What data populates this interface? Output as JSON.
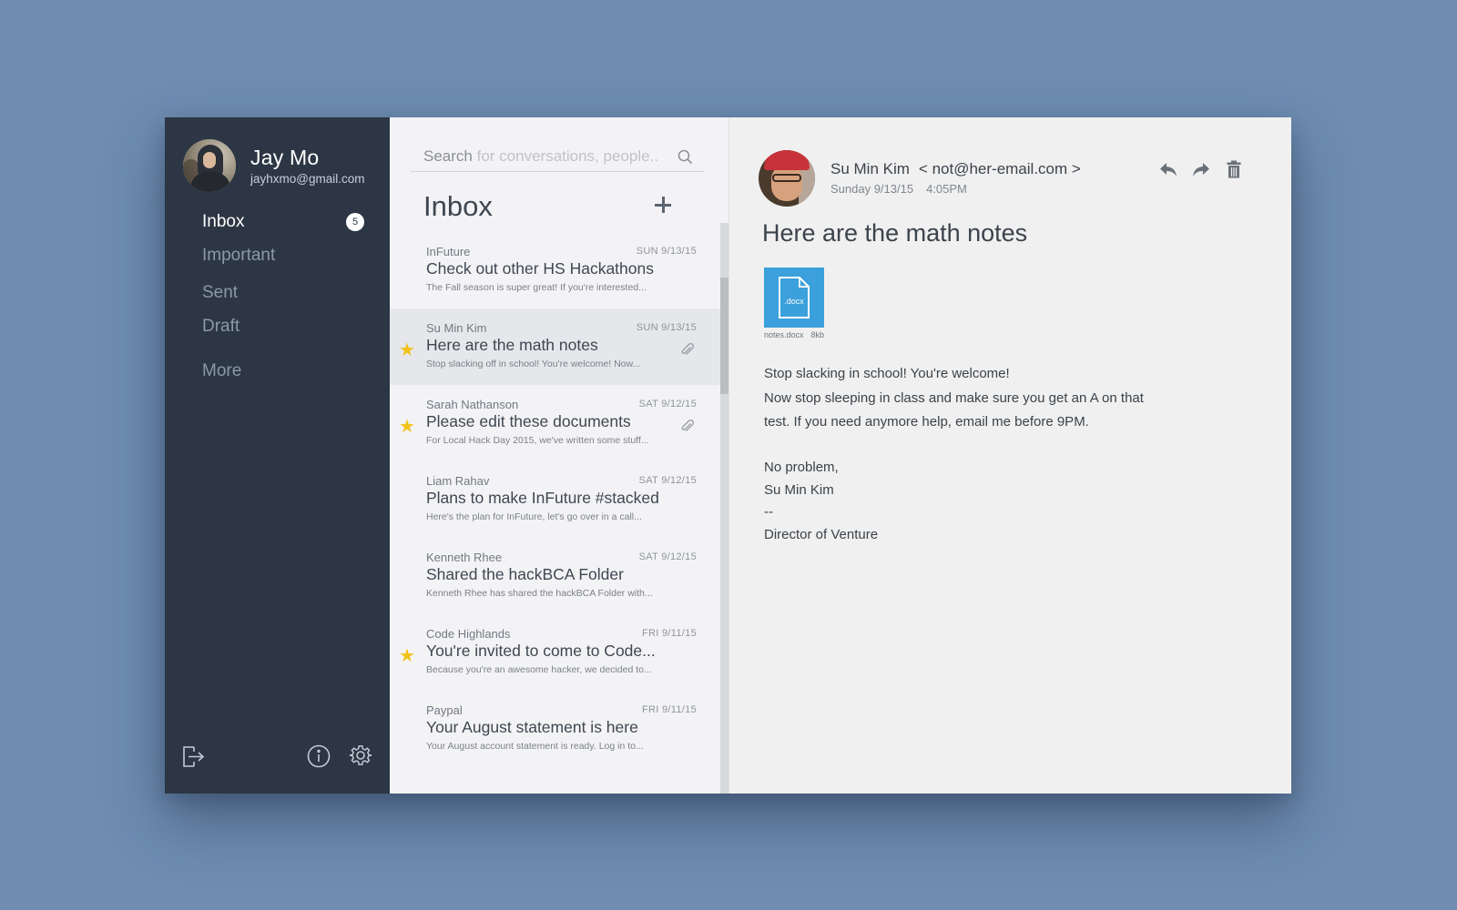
{
  "user": {
    "name": "Jay Mo",
    "email": "jayhxmo@gmail.com"
  },
  "nav": {
    "items": [
      {
        "label": "Inbox",
        "badge": "5",
        "active": true
      },
      {
        "label": "Important"
      },
      {
        "label": "Sent"
      },
      {
        "label": "Draft"
      },
      {
        "label": "More"
      }
    ]
  },
  "footer_icons": [
    "logout-icon",
    "info-icon",
    "gear-icon"
  ],
  "search": {
    "label": "Search",
    "placeholder": "for conversations, people.."
  },
  "list": {
    "title": "Inbox",
    "messages": [
      {
        "from": "InFuture",
        "date": "SUN 9/13/15",
        "subject": "Check out other HS Hackathons",
        "preview": "The Fall season is super great!  If you're interested...",
        "starred": false,
        "attachment": false,
        "selected": false
      },
      {
        "from": "Su Min Kim",
        "date": "SUN 9/13/15",
        "subject": "Here are the math notes",
        "preview": "Stop slacking off in school! You're welcome! Now...",
        "starred": true,
        "attachment": true,
        "selected": true
      },
      {
        "from": "Sarah Nathanson",
        "date": "SAT 9/12/15",
        "subject": "Please edit these documents",
        "preview": "For Local Hack Day 2015, we've written some stuff...",
        "starred": true,
        "attachment": true,
        "selected": false
      },
      {
        "from": "Liam Rahav",
        "date": "SAT 9/12/15",
        "subject": "Plans to make InFuture #stacked",
        "preview": "Here's the plan for InFuture, let's go over in a call...",
        "starred": false,
        "attachment": false,
        "selected": false
      },
      {
        "from": "Kenneth Rhee",
        "date": "SAT 9/12/15",
        "subject": "Shared the hackBCA Folder",
        "preview": "Kenneth Rhee has shared the hackBCA Folder with...",
        "starred": false,
        "attachment": false,
        "selected": false
      },
      {
        "from": "Code Highlands",
        "date": "FRI 9/11/15",
        "subject": "You're invited to come to Code...",
        "preview": "Because you're an awesome hacker, we decided to...",
        "starred": true,
        "attachment": false,
        "selected": false
      },
      {
        "from": "Paypal",
        "date": "FRI 9/11/15",
        "subject": "Your August statement is here",
        "preview": "Your August account statement is ready. Log in to...",
        "starred": false,
        "attachment": false,
        "selected": false
      }
    ],
    "scroll_position": 0.12
  },
  "email": {
    "sender_name": "Su Min Kim",
    "sender_email": "< not@her-email.com >",
    "date": "Sunday 9/13/15",
    "time": "4:05PM",
    "subject": "Here are the math notes",
    "attachment": {
      "ext": ".docx",
      "filename": "notes.docx",
      "size": "8kb"
    },
    "body": [
      "Stop slacking in school! You're welcome!",
      "Now stop sleeping in class and make sure you get an A on that",
      "test. If you need anymore help, email me before 9PM."
    ],
    "signature": [
      "No problem,",
      "Su Min Kim",
      "--",
      "Director of Venture"
    ],
    "action_icons": [
      "reply-icon",
      "forward-icon",
      "trash-icon"
    ]
  },
  "colors": {
    "background": "#6e8db1",
    "sidebar": "#2c3644",
    "star": "#f2c21b",
    "attachment_tile": "#3ba0dc"
  }
}
